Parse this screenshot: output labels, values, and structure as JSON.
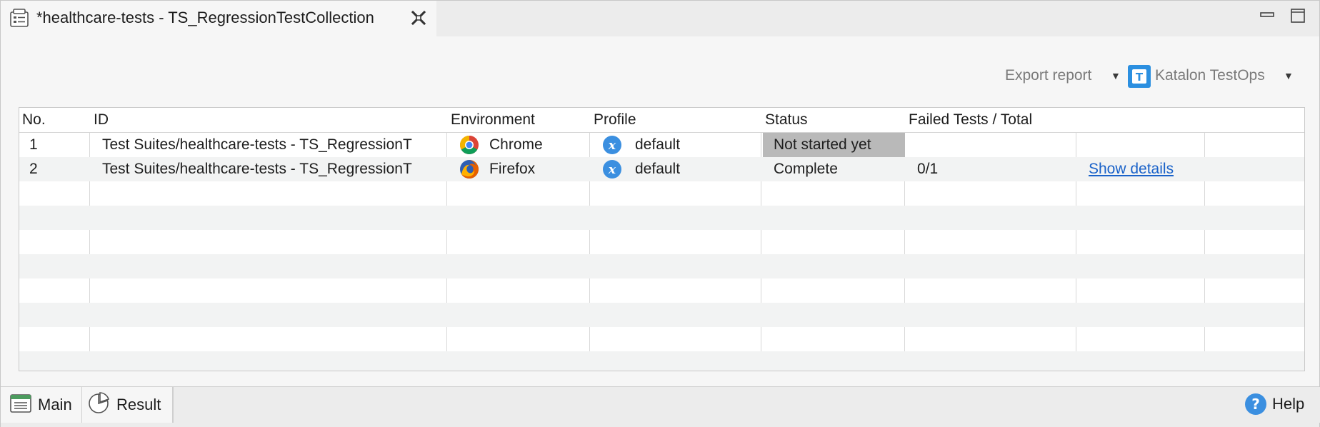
{
  "window": {
    "tab_title": "*healthcare-tests - TS_RegressionTestCollection"
  },
  "toolbar": {
    "export_label": "Export report",
    "testops_label": "Katalon TestOps"
  },
  "table": {
    "headers": [
      "No.",
      "ID",
      "Environment",
      "Profile",
      "Status",
      "Failed Tests / Total"
    ],
    "rows": [
      {
        "no": "1",
        "id": "Test Suites/healthcare-tests - TS_RegressionT",
        "environment": "Chrome",
        "environment_icon": "chrome-icon",
        "profile": "default",
        "status": "Not started yet",
        "failed_total": "",
        "action": ""
      },
      {
        "no": "2",
        "id": "Test Suites/healthcare-tests - TS_RegressionT",
        "environment": "Firefox",
        "environment_icon": "firefox-icon",
        "profile": "default",
        "status": "Complete",
        "failed_total": "0/1",
        "action": "Show details"
      }
    ]
  },
  "bottom_tabs": [
    "Main",
    "Result"
  ],
  "help_label": "Help",
  "colors": {
    "link": "#1a62c9",
    "status_not_started_bg": "#b9b9b9",
    "profile_icon": "#3b8fe0",
    "testops_brand": "#2b8fe0"
  }
}
